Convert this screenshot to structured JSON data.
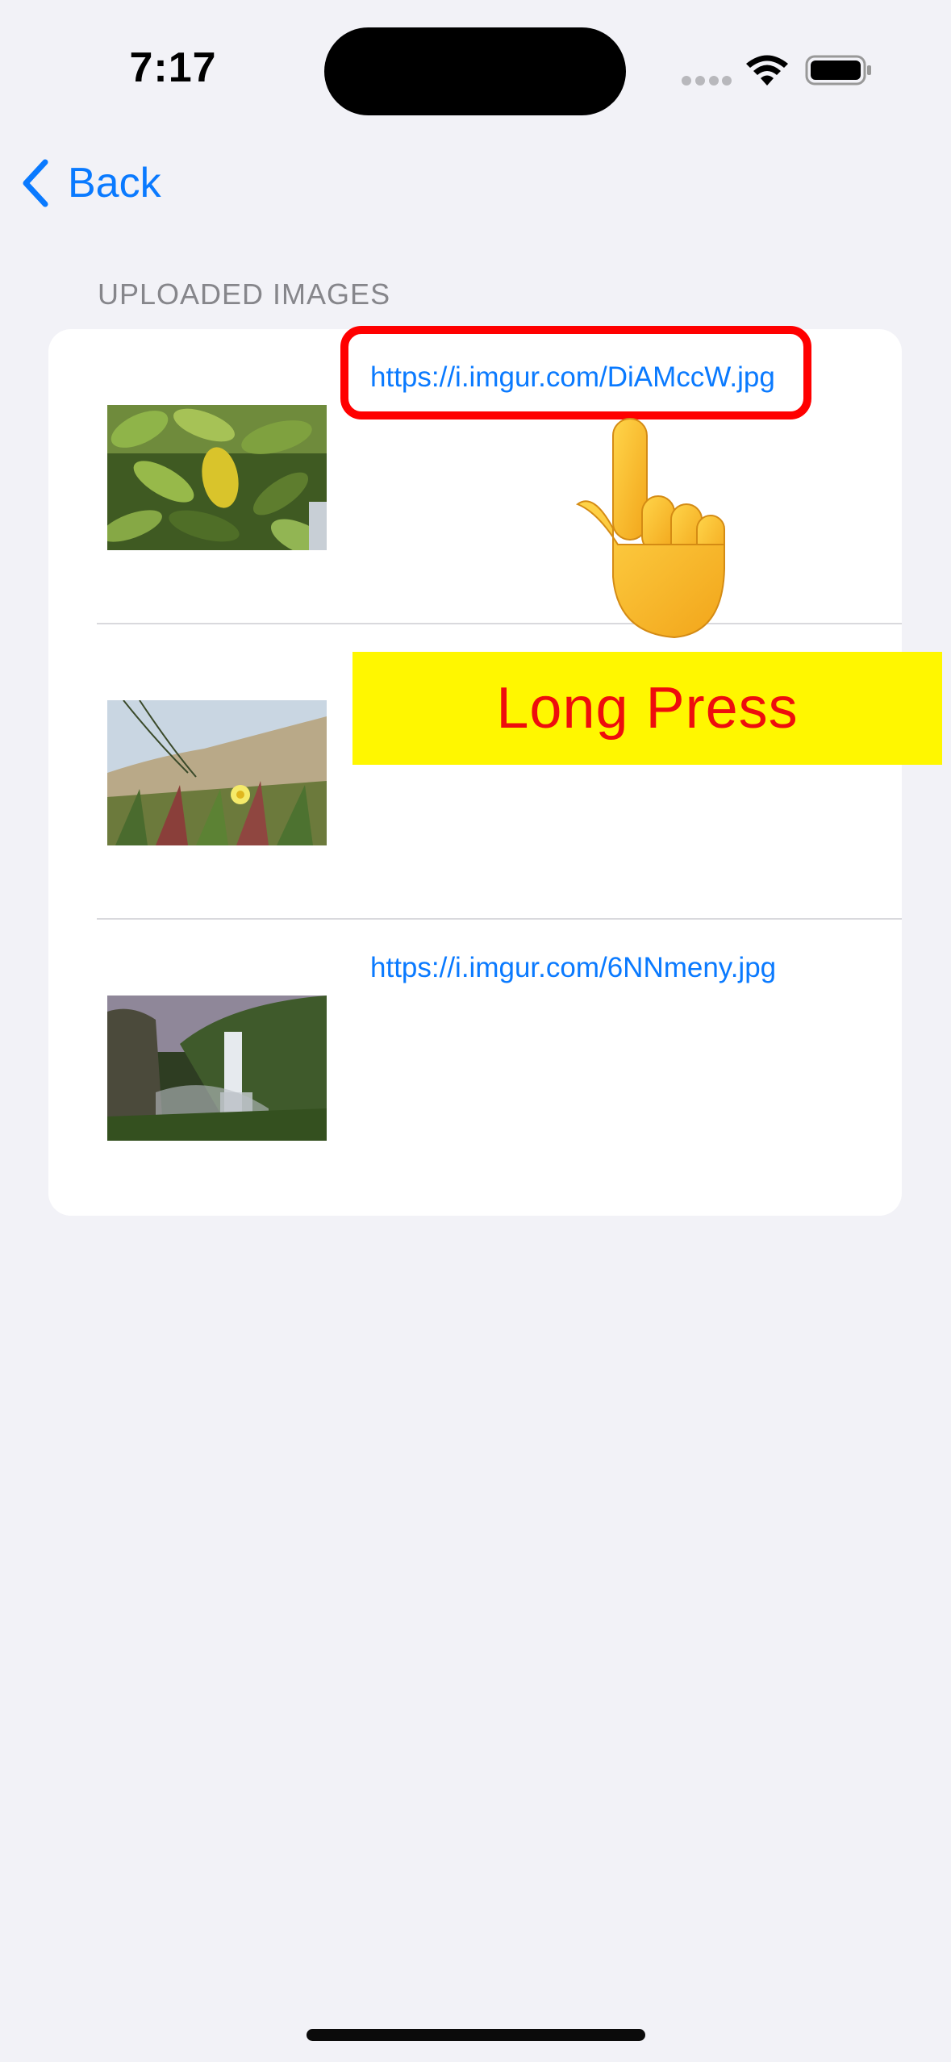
{
  "status_bar": {
    "time": "7:17",
    "icons": [
      "cellular-signal-icon",
      "wifi-icon",
      "battery-icon"
    ]
  },
  "nav": {
    "back_label": "Back",
    "back_icon": "chevron-left-icon"
  },
  "section": {
    "header": "UPLOADED IMAGES"
  },
  "rows": [
    {
      "url": "https://i.imgur.com/DiAMccW.jpg",
      "thumbnail": "green-leaves-with-yellow-leaf"
    },
    {
      "url": "",
      "thumbnail": "dune-grass-with-yellow-flower"
    },
    {
      "url": "https://i.imgur.com/6NNmeny.jpg",
      "thumbnail": "waterfall-cliffs"
    }
  ],
  "tutorial": {
    "banner_text": "Long Press",
    "pointer_icon": "pointing-hand-icon"
  },
  "colors": {
    "accent": "#0a7aff",
    "background": "#f2f2f7",
    "highlight": "#ff0000",
    "banner": "#fff700"
  }
}
